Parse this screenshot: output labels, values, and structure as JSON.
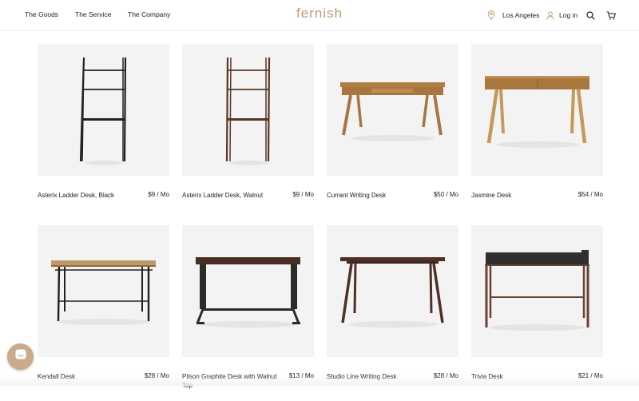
{
  "header": {
    "nav": [
      "The Goods",
      "The Service",
      "The Company"
    ],
    "logo": "fernish",
    "location": "Los Angeles",
    "login": "Log in",
    "icons": [
      "location-pin-icon",
      "user-icon",
      "search-icon",
      "cart-icon"
    ]
  },
  "products": [
    {
      "name": "Asterix Ladder Desk, Black",
      "price": "$9 / Mo"
    },
    {
      "name": "Asterix Ladder Desk, Walnut",
      "price": "$9 / Mo"
    },
    {
      "name": "Currant Writing Desk",
      "price": "$50 / Mo"
    },
    {
      "name": "Jasmine Desk",
      "price": "$54 / Mo"
    },
    {
      "name": "Kendall Desk",
      "price": "$28 / Mo"
    },
    {
      "name": "Pilson Graphite Desk with Walnut Top",
      "price": "$13 / Mo"
    },
    {
      "name": "Studio Line Writing Desk",
      "price": "$28 / Mo"
    },
    {
      "name": "Trivia Desk",
      "price": "$21 / Mo"
    }
  ],
  "colors": {
    "brand": "#c29b72",
    "chat": "#c9ab8b",
    "image_bg": "#f3f3f3"
  }
}
